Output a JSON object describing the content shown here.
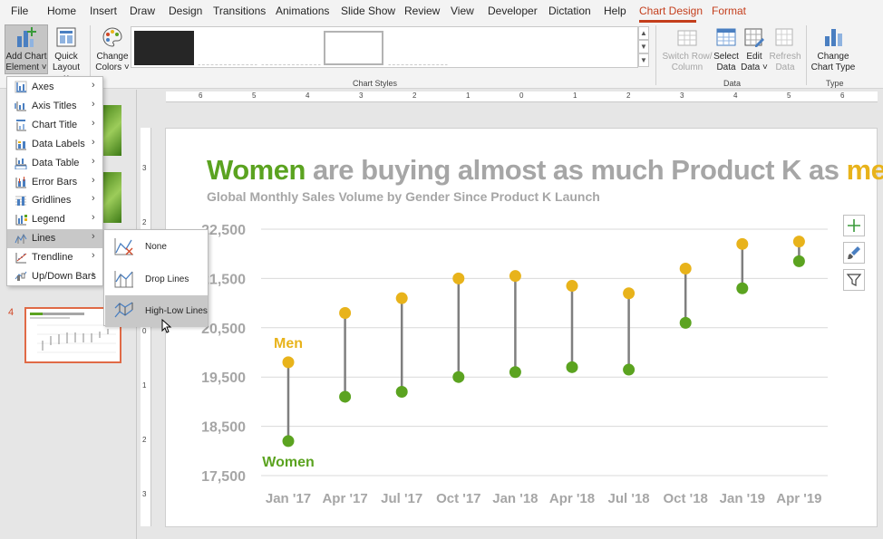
{
  "tabs": [
    {
      "label": "File"
    },
    {
      "label": "Home"
    },
    {
      "label": "Insert"
    },
    {
      "label": "Draw"
    },
    {
      "label": "Design"
    },
    {
      "label": "Transitions"
    },
    {
      "label": "Animations"
    },
    {
      "label": "Slide Show"
    },
    {
      "label": "Review"
    },
    {
      "label": "View"
    },
    {
      "label": "Developer"
    },
    {
      "label": "Dictation"
    },
    {
      "label": "Help"
    },
    {
      "label": "Chart Design"
    },
    {
      "label": "Format"
    }
  ],
  "active_tab": "Chart Design",
  "ribbon": {
    "add_chart_element": {
      "line1": "Add Chart",
      "line2": "Element ˅"
    },
    "quick_layout": {
      "line1": "Quick",
      "line2": "Layout ˅"
    },
    "change_colors": {
      "line1": "Change",
      "line2": "Colors ˅"
    },
    "chart_styles_label": "Chart Styles",
    "switch_row_column": {
      "line1": "Switch Row/",
      "line2": "Column"
    },
    "select_data": {
      "line1": "Select",
      "line2": "Data"
    },
    "edit_data": {
      "line1": "Edit",
      "line2": "Data ˅"
    },
    "refresh_data": {
      "line1": "Refresh",
      "line2": "Data"
    },
    "data_label": "Data",
    "change_chart_type": {
      "line1": "Change",
      "line2": "Chart Type"
    },
    "type_label": "Type"
  },
  "slide_number": "4",
  "ruler": {
    "h_ticks": [
      "6",
      "5",
      "4",
      "3",
      "2",
      "1",
      "0",
      "1",
      "2",
      "3",
      "4",
      "5",
      "6"
    ],
    "v_ticks": [
      "3",
      "2",
      "1",
      "0",
      "1",
      "2",
      "3"
    ]
  },
  "slide": {
    "title_part1": "Women",
    "title_part2": " are buying almost as much Product K as ",
    "title_part3": "men",
    "title_part4": ".",
    "subtitle": "Global Monthly Sales Volume by Gender Since Product K Launch"
  },
  "colors": {
    "women": "#5ba320",
    "men": "#e8b31b",
    "connector": "#7f7f7f",
    "gridline": "#d9d9d9",
    "axis_text": "#a6a6a6",
    "accent": "#c43e1c"
  },
  "chart_data": {
    "type": "scatter",
    "subtype": "high-low lines",
    "categories": [
      "Jan '17",
      "Apr '17",
      "Jul '17",
      "Oct '17",
      "Jan '18",
      "Apr '18",
      "Jul '18",
      "Oct '18",
      "Jan '19",
      "Apr '19"
    ],
    "series": [
      {
        "name": "Men",
        "values": [
          19800,
          20800,
          21100,
          21500,
          21550,
          21350,
          21200,
          21700,
          22200,
          22250
        ]
      },
      {
        "name": "Women",
        "values": [
          18200,
          19100,
          19200,
          19500,
          19600,
          19700,
          19650,
          20600,
          21300,
          21850
        ]
      }
    ],
    "y_ticks": [
      "22,500",
      "21,500",
      "20,500",
      "19,500",
      "18,500",
      "17,500"
    ],
    "ylim": [
      17500,
      22500
    ],
    "grid": true,
    "legend": "inline labels"
  },
  "side_buttons": [
    {
      "icon": "plus-icon"
    },
    {
      "icon": "brush-icon"
    },
    {
      "icon": "filter-icon"
    }
  ],
  "menu": {
    "items": [
      {
        "label": "Axes",
        "icon": "axes-icon"
      },
      {
        "label": "Axis Titles",
        "icon": "axis-titles-icon"
      },
      {
        "label": "Chart Title",
        "icon": "chart-title-icon"
      },
      {
        "label": "Data Labels",
        "icon": "data-labels-icon"
      },
      {
        "label": "Data Table",
        "icon": "data-table-icon"
      },
      {
        "label": "Error Bars",
        "icon": "error-bars-icon"
      },
      {
        "label": "Gridlines",
        "icon": "gridlines-icon"
      },
      {
        "label": "Legend",
        "icon": "legend-icon"
      },
      {
        "label": "Lines",
        "icon": "lines-icon"
      },
      {
        "label": "Trendline",
        "icon": "trendline-icon"
      },
      {
        "label": "Up/Down Bars",
        "icon": "up-down-bars-icon"
      }
    ],
    "hovered": "Lines"
  },
  "submenu": {
    "items": [
      {
        "label": "None",
        "icon": "none-lines-icon"
      },
      {
        "label": "Drop Lines",
        "icon": "drop-lines-icon"
      },
      {
        "label": "High-Low Lines",
        "icon": "high-low-lines-icon"
      }
    ],
    "hovered": "High-Low Lines"
  }
}
